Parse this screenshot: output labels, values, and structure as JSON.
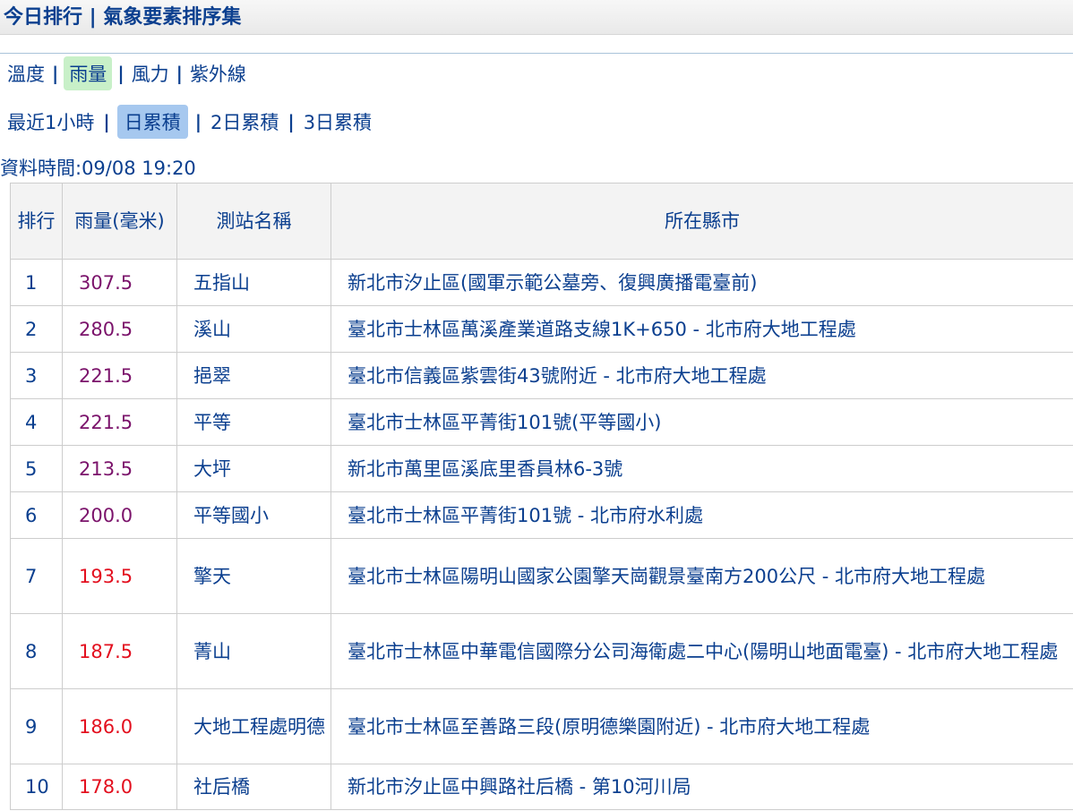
{
  "header": {
    "title": "今日排行 | 氣象要素排序集"
  },
  "nav_elements": [
    "溫度",
    "雨量",
    "風力",
    "紫外線"
  ],
  "nav_periods": [
    "最近1小時",
    "日累積",
    "2日累積",
    "3日累積"
  ],
  "data_time": "資料時間:09/08 19:20",
  "table": {
    "headers": {
      "rank": "排行",
      "rain": "雨量(毫米)",
      "station": "測站名稱",
      "location": "所在縣市"
    },
    "rows": [
      {
        "rank": "1",
        "rain": "307.5",
        "station": "五指山",
        "location": "新北市汐止區(國軍示範公墓旁、復興廣播電臺前)"
      },
      {
        "rank": "2",
        "rain": "280.5",
        "station": "溪山",
        "location": "臺北市士林區萬溪產業道路支線1K+650 - 北市府大地工程處"
      },
      {
        "rank": "3",
        "rain": "221.5",
        "station": "挹翠",
        "location": "臺北市信義區紫雲街43號附近 - 北市府大地工程處"
      },
      {
        "rank": "4",
        "rain": "221.5",
        "station": "平等",
        "location": "臺北市士林區平菁街101號(平等國小)"
      },
      {
        "rank": "5",
        "rain": "213.5",
        "station": "大坪",
        "location": "新北市萬里區溪底里香員林6-3號"
      },
      {
        "rank": "6",
        "rain": "200.0",
        "station": "平等國小",
        "location": "臺北市士林區平菁街101號 - 北市府水利處"
      },
      {
        "rank": "7",
        "rain": "193.5",
        "station": "擎天",
        "location": "臺北市士林區陽明山國家公園擎天崗觀景臺南方200公尺 - 北市府大地工程處"
      },
      {
        "rank": "8",
        "rain": "187.5",
        "station": "菁山",
        "location": "臺北市士林區中華電信國際分公司海衛處二中心(陽明山地面電臺) - 北市府大地工程處"
      },
      {
        "rank": "9",
        "rain": "186.0",
        "station": "大地工程處明德",
        "location": "臺北市士林區至善路三段(原明德樂園附近) - 北市府大地工程處"
      },
      {
        "rank": "10",
        "rain": "178.0",
        "station": "社后橋",
        "location": "新北市汐止區中興路社后橋 - 第10河川局"
      }
    ]
  },
  "colors": {
    "text": "#0b3f8f",
    "value_high": "#7b136b",
    "value_mid": "#e30f1e"
  }
}
